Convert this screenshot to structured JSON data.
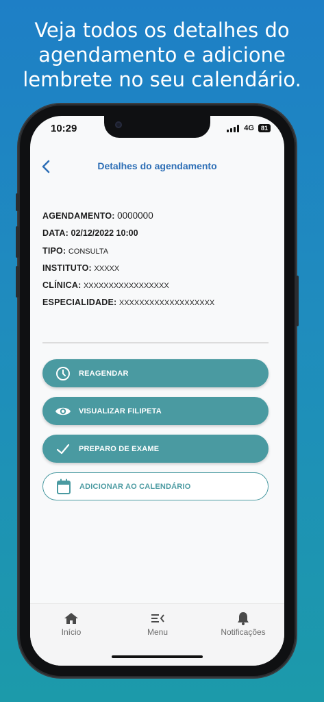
{
  "promo": {
    "line1": "Veja todos os detalhes do",
    "line2": "agendamento e adicione",
    "line3": "lembrete no seu calendário."
  },
  "status_bar": {
    "time": "10:29",
    "network": "4G",
    "battery": "81"
  },
  "header": {
    "title": "Detalhes do agendamento"
  },
  "details": [
    {
      "label": "AGENDAMENTO:",
      "value": "0000000"
    },
    {
      "label": "DATA:",
      "value": "02/12/2022 10:00"
    },
    {
      "label": "TIPO:",
      "value": "CONSULTA"
    },
    {
      "label": "INSTITUTO:",
      "value": "XXXXX"
    },
    {
      "label": "CLÍNICA:",
      "value": "XXXXXXXXXXXXXXXXX"
    },
    {
      "label": "ESPECIALIDADE:",
      "value": "XXXXXXXXXXXXXXXXXXX"
    }
  ],
  "actions": [
    {
      "label": "REAGENDAR",
      "icon": "clock-icon"
    },
    {
      "label": "VISUALIZAR FILIPETA",
      "icon": "eye-icon"
    },
    {
      "label": "PREPARO DE EXAME",
      "icon": "check-icon"
    },
    {
      "label": "ADICIONAR AO CALENDÁRIO",
      "icon": "calendar-icon"
    }
  ],
  "tabs": [
    {
      "label": "Início",
      "icon": "home-icon"
    },
    {
      "label": "Menu",
      "icon": "menu-icon"
    },
    {
      "label": "Notificações",
      "icon": "bell-icon"
    }
  ],
  "colors": {
    "accent": "#4a9aa1",
    "title_blue": "#2e6fb6",
    "background_top": "#1e7fc6",
    "background_bottom": "#1c9aaa"
  }
}
